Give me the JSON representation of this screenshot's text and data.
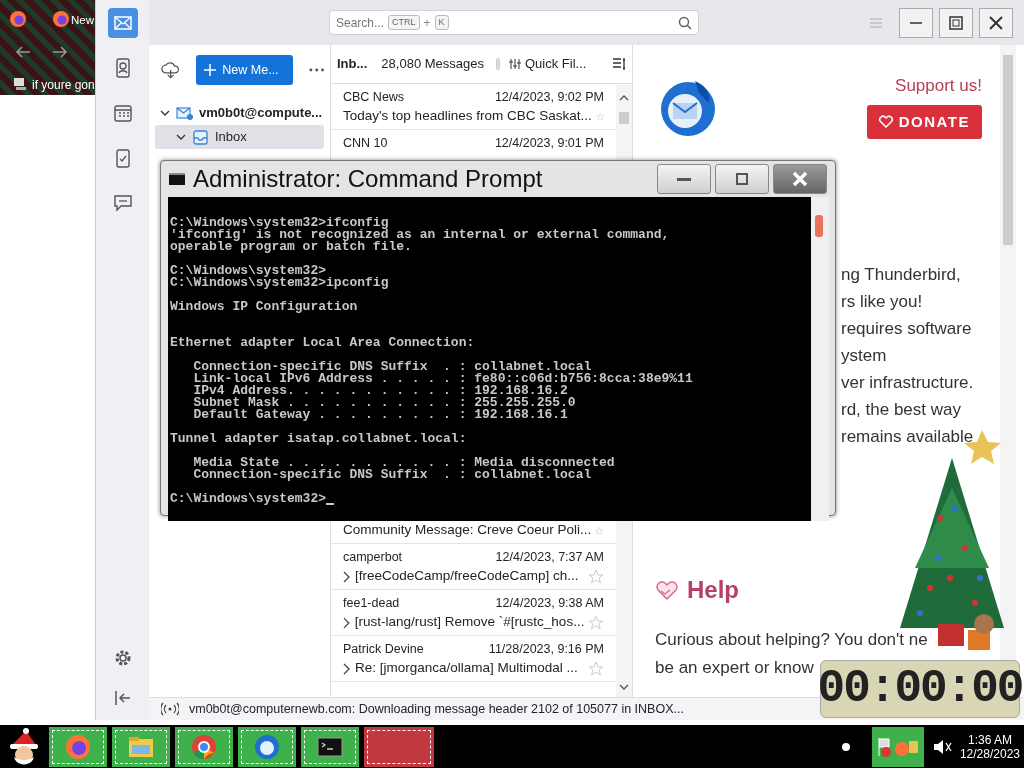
{
  "background_window": {
    "tab_title": "New",
    "bookmark": "if youre gon"
  },
  "thunderbird": {
    "spaces": [
      {
        "kind": "mail",
        "selected": true
      },
      {
        "kind": "address_book",
        "selected": false
      },
      {
        "kind": "calendar",
        "selected": false
      },
      {
        "kind": "tasks",
        "selected": false
      },
      {
        "kind": "chat",
        "selected": false
      }
    ],
    "search": {
      "placeholder": "Search...",
      "shortcut_keys": [
        "CTRL",
        "K"
      ],
      "shortcut_joiner": "+"
    },
    "new_message_button": "New Me...",
    "folders": [
      {
        "name": "vm0b0t@compute...",
        "kind": "account",
        "expanded": true,
        "selected": false,
        "children": [
          {
            "name": "Inbox",
            "kind": "inbox",
            "expanded": true,
            "selected": true
          }
        ]
      }
    ],
    "message_list": {
      "folder": "Inb...",
      "count": "28,080 Messages",
      "quick_filter_toggle": {
        "on": false
      },
      "quick_filter": "Quick Fil...",
      "rows": [
        {
          "sender": "CBC News",
          "date": "12/4/2023, 9:02 PM",
          "subject": "Today's top headlines from CBC Saskat...",
          "threaded": false,
          "starred": false
        },
        {
          "sender": "CNN 10",
          "date": "12/4/2023, 9:01 PM"
        },
        {
          "subject": "Community Message: Creve Coeur Poli...",
          "threaded": false,
          "starred": false
        },
        {
          "sender": "camperbot",
          "date": "12/4/2023, 7:37 AM",
          "subject": "[freeCodeCamp/freeCodeCamp] ch...",
          "threaded": true,
          "starred": false
        },
        {
          "sender": "fee1-dead",
          "date": "12/4/2023, 9:38 AM",
          "subject": "[rust-lang/rust] Remove `#[rustc_hos...",
          "threaded": true,
          "starred": false
        },
        {
          "sender": "Patrick Devine",
          "date": "11/28/2023, 9:16 PM",
          "subject": "Re: [jmorganca/ollama] Multimodal ...",
          "threaded": true,
          "starred": false
        }
      ]
    },
    "start_page": {
      "support": "Support us!",
      "donate": "DONATE",
      "paragraph_lines": [
        "ng Thunderbird,",
        "rs like you!",
        "requires software",
        "ystem",
        "ver infrastructure.",
        "rd, the best way",
        "remains available"
      ],
      "help_heading": "Help",
      "help_lines": [
        "Curious about helping? You don't ne",
        "be an expert or know"
      ]
    },
    "status": "vm0b0t@computernewb.com: Downloading message header 2102 of 105077 in INBOX..."
  },
  "cmd": {
    "title": "Administrator: Command Prompt",
    "blocks": [
      {
        "lines": [
          "C:\\Windows\\system32>ifconfig",
          "'ifconfig' is not recognized as an internal or external command,",
          "operable program or batch file."
        ]
      },
      {
        "lines": [
          "C:\\Windows\\system32>",
          "C:\\Windows\\system32>ipconfig"
        ]
      },
      {
        "lines": [
          "Windows IP Configuration"
        ]
      },
      {
        "lines": [
          "Ethernet adapter Local Area Connection:"
        ]
      },
      {
        "lines": [
          "   Connection-specific DNS Suffix  . : collabnet.local",
          "   Link-local IPv6 Address . . . . . : fe80::c06d:b756:8cca:38e9%11",
          "   IPv4 Address. . . . . . . . . . . : 192.168.16.2",
          "   Subnet Mask . . . . . . . . . . . : 255.255.255.0",
          "   Default Gateway . . . . . . . . . : 192.168.16.1"
        ]
      },
      {
        "lines": [
          "Tunnel adapter isatap.collabnet.local:"
        ]
      },
      {
        "lines": [
          "   Media State . . . . . . . . . . . : Media disconnected",
          "   Connection-specific DNS Suffix  . : collabnet.local"
        ]
      },
      {
        "lines": [
          "C:\\Windows\\system32>"
        ],
        "cursor": true
      }
    ]
  },
  "timer": "00:00:00",
  "taskbar": {
    "apps": [
      {
        "kind": "firefox"
      },
      {
        "kind": "explorer"
      },
      {
        "kind": "chrome"
      },
      {
        "kind": "thunderbird"
      },
      {
        "kind": "terminal"
      },
      {
        "kind": "empty"
      }
    ],
    "time": "1:36 AM",
    "date": "12/28/2023"
  }
}
